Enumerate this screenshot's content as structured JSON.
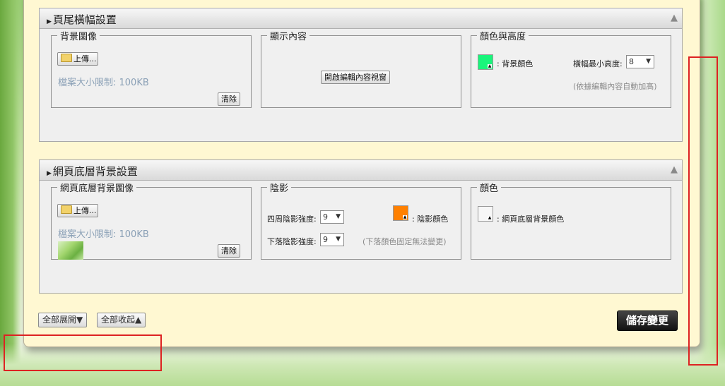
{
  "footer_banner": {
    "title": "頁尾橫幅設置",
    "background_image": {
      "legend": "背景圖像",
      "upload_label": "上傳...",
      "size_limit": "檔案大小限制: 100KB",
      "clear_label": "清除"
    },
    "display_content": {
      "legend": "顯示內容",
      "open_editor_label": "開啟編輯內容視窗"
    },
    "color_height": {
      "legend": "顏色與高度",
      "bg_color_label": ": 背景顏色",
      "bg_color": "#19f57b",
      "min_height_label": "橫幅最小高度:",
      "min_height_value": "8",
      "auto_note": "(依據編輯內容自動加高)"
    }
  },
  "page_bottom_bg": {
    "title": "網頁底層背景設置",
    "background_image": {
      "legend": "網頁底層背景圖像",
      "upload_label": "上傳...",
      "size_limit": "檔案大小限制: 100KB",
      "clear_label": "清除"
    },
    "shadow": {
      "legend": "陰影",
      "around_label": "四周陰影強度:",
      "around_value": "9",
      "drop_label": "下落陰影強度:",
      "drop_value": "9",
      "shadow_color_label": ": 陰影顏色",
      "shadow_color": "#ff8000",
      "drop_note": "(下落顏色固定無法變更)"
    },
    "color": {
      "legend": "顏色",
      "bg_color_label": ": 網頁底層背景顏色",
      "bg_color": "#f7f7f7"
    }
  },
  "footer": {
    "expand_all": "全部展開▼",
    "collapse_all": "全部收起▲",
    "save": "儲存變更"
  }
}
